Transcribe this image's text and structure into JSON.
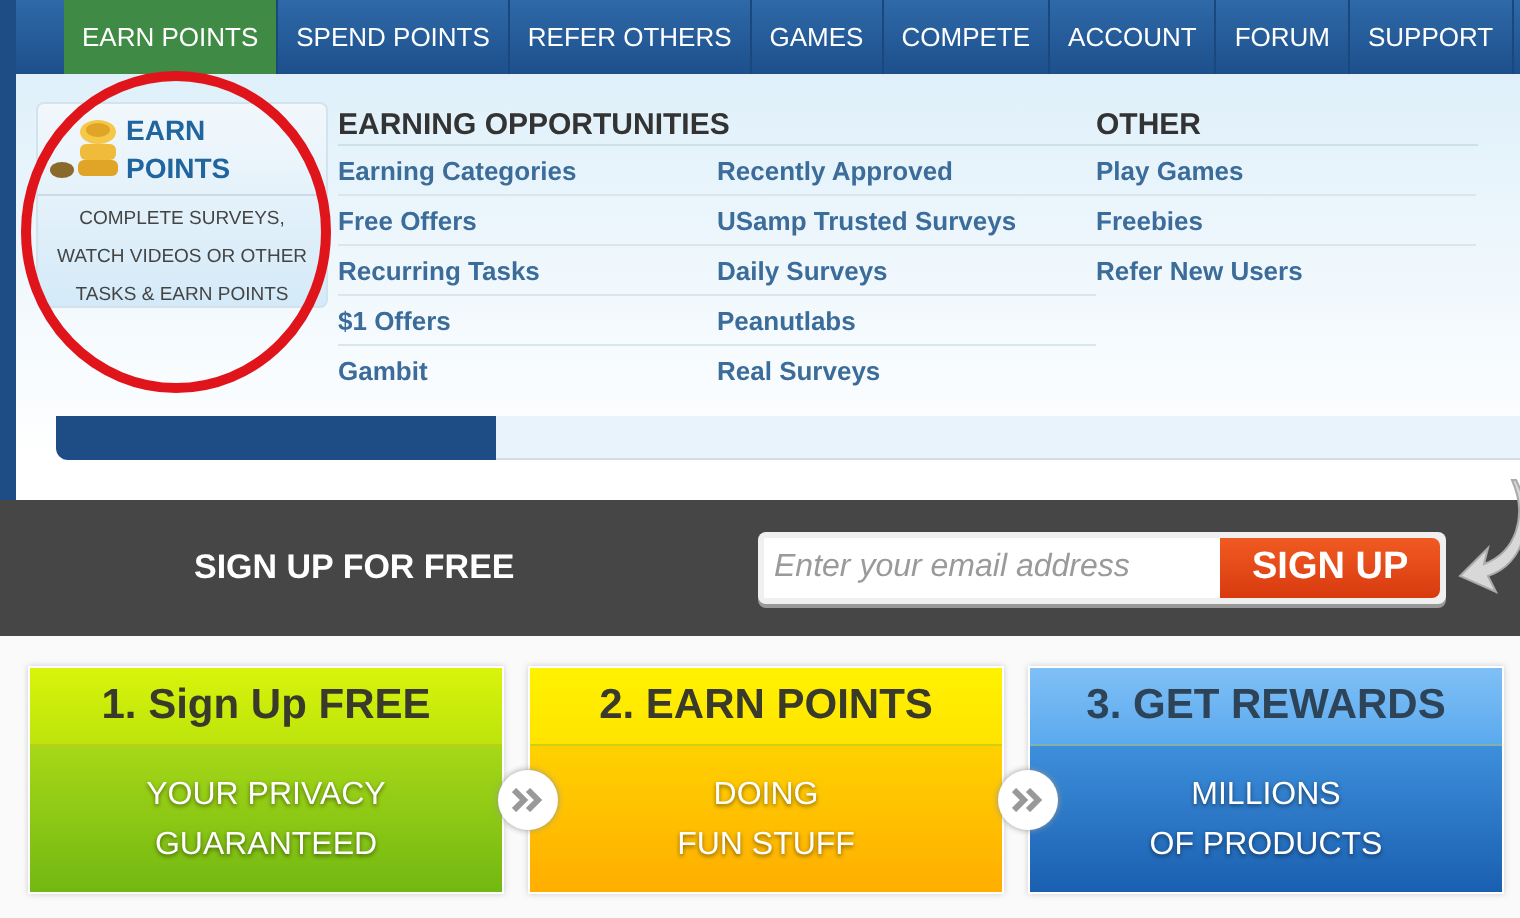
{
  "nav": [
    {
      "label": "EARN POINTS",
      "selected": true
    },
    {
      "label": "SPEND POINTS",
      "selected": false
    },
    {
      "label": "REFER OTHERS",
      "selected": false
    },
    {
      "label": "GAMES",
      "selected": false
    },
    {
      "label": "COMPETE",
      "selected": false
    },
    {
      "label": "ACCOUNT",
      "selected": false
    },
    {
      "label": "FORUM",
      "selected": false
    },
    {
      "label": "SUPPORT",
      "selected": false
    }
  ],
  "promo": {
    "title_line_1": "EARN",
    "title_line_2": "POINTS",
    "description": "COMPLETE SURVEYS, WATCH VIDEOS OR OTHER TASKS & EARN POINTS"
  },
  "menu_columns": [
    {
      "heading": "EARNING OPPORTUNITIES",
      "links": [
        [
          "Earning Categories",
          "Free Offers",
          "Recurring Tasks",
          "$1 Offers",
          "Gambit"
        ],
        [
          "Recently Approved",
          "USamp Trusted Surveys",
          "Daily Surveys",
          "Peanutlabs",
          "Real Surveys"
        ]
      ]
    },
    {
      "heading": "OTHER",
      "links": [
        [
          "Play Games",
          "Freebies",
          "Refer New Users"
        ]
      ]
    }
  ],
  "signup": {
    "label": "SIGN UP FOR FREE",
    "placeholder": "Enter your email address",
    "button": "SIGN UP"
  },
  "steps": [
    {
      "kind": "green",
      "title": "1. Sign Up FREE",
      "lines": [
        "YOUR PRIVACY",
        "GUARANTEED"
      ]
    },
    {
      "kind": "yellow",
      "title": "2. EARN POINTS",
      "lines": [
        "DOING",
        "FUN STUFF"
      ]
    },
    {
      "kind": "blue",
      "title": "3. GET REWARDS",
      "lines": [
        "MILLIONS",
        "OF PRODUCTS"
      ]
    }
  ]
}
